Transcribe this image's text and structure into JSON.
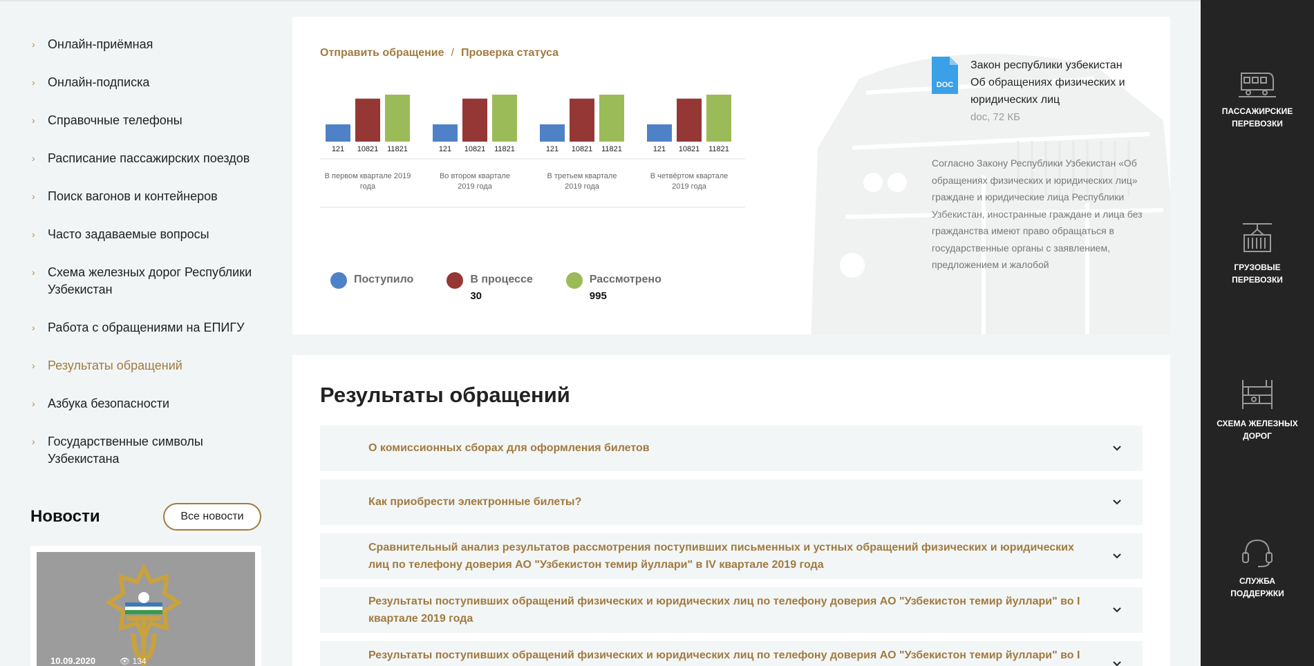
{
  "left_nav": {
    "items": [
      {
        "label": "Онлайн-приёмная"
      },
      {
        "label": "Онлайн-подписка"
      },
      {
        "label": "Справочные телефоны"
      },
      {
        "label": "Расписание пассажирских поездов"
      },
      {
        "label": "Поиск вагонов и контейнеров"
      },
      {
        "label": "Часто задаваемые вопросы"
      },
      {
        "label": "Схема железных дорог Республики Узбекистан"
      },
      {
        "label": "Работа с обращениями на ЕПИГУ"
      },
      {
        "label": "Результаты обращений"
      },
      {
        "label": "Азбука безопасности"
      },
      {
        "label": "Государственные символы Узбекистана"
      }
    ],
    "active_label": "Результаты обращений"
  },
  "news": {
    "title": "Новости",
    "all_button": "Все новости",
    "card": {
      "date": "10.09.2020",
      "views": "134"
    }
  },
  "breadcrumb": {
    "link1": "Отправить обращение",
    "separator": "/",
    "link2": "Проверка статуса"
  },
  "chart_data": {
    "type": "bar",
    "categories": [
      "В первом квартале 2019 года",
      "Во втором квартале 2019 года",
      "В третьем квартале 2019 года",
      "В четвёртом квартале 2019 года"
    ],
    "series": [
      {
        "name": "Поступило",
        "color": "#4f81c7",
        "values": [
          121,
          121,
          121,
          121
        ],
        "value_labels": [
          "121",
          "121",
          "121",
          "121"
        ]
      },
      {
        "name": "В процессе",
        "color": "#953735",
        "values": [
          10821,
          10821,
          10821,
          10821
        ],
        "value_labels": [
          "10821",
          "10821",
          "10821",
          "10821"
        ]
      },
      {
        "name": "Рассмотрено",
        "color": "#9bbb59",
        "values": [
          11821,
          11821,
          11821,
          11821
        ],
        "value_labels": [
          "11821",
          "11821",
          "11821",
          "11821"
        ]
      }
    ],
    "ylim": [
      0,
      11821
    ],
    "legend_position": "bottom-left",
    "grid": false
  },
  "legend": [
    {
      "name": "Поступило",
      "color": "#4f81c7",
      "value": ""
    },
    {
      "name": "В процессе",
      "color": "#953735",
      "value": "30"
    },
    {
      "name": "Рассмотрено",
      "color": "#9bbb59",
      "value": "995"
    }
  ],
  "document": {
    "icon": "doc-file-icon",
    "icon_text": "DOC",
    "title": "Закон республики узбекистан Об обращениях физических и юридических лиц",
    "meta": "doc, 72 КБ",
    "description": "Согласно Закону Республики Узбекистан «Об обращениях физических и юридических лиц» граждане и юридические лица Республики Узбекистан, иностранные граждане и лица без гражданства имеют право обращаться в государственные органы с заявлением, предложением и жалобой"
  },
  "results": {
    "title": "Результаты обращений",
    "items": [
      {
        "text": "О комиссионных сборах для оформления билетов"
      },
      {
        "text": "Как приобрести электронные билеты?"
      },
      {
        "text": "Сравнительный анализ результатов рассмотрения поступивших письменных и устных обращений физических и юридических лиц по телефону доверия АО \"Узбекистон темир йуллари\" в IV квартале 2019 года"
      },
      {
        "text": "Результаты поступивших обращений физических и юридических лиц по телефону доверия АО \"Узбекистон темир йуллари\" во I квартале 2019 года"
      },
      {
        "text": "Результаты поступивших обращений физических и юридических лиц по телефону доверия АО \"Узбекистон темир йуллари\" во I квартале"
      }
    ]
  },
  "right_panel": {
    "items": [
      {
        "label_line1": "ПАССАЖИРСКИЕ",
        "label_line2": "ПЕРЕВОЗКИ",
        "icon": "train-icon"
      },
      {
        "label_line1": "ГРУЗОВЫЕ",
        "label_line2": "ПЕРЕВОЗКИ",
        "icon": "cargo-container-icon"
      },
      {
        "label_line1": "СХЕМА ЖЕЛЕЗНЫХ",
        "label_line2": "ДОРОГ",
        "icon": "rail-map-icon"
      },
      {
        "label_line1": "СЛУЖБА",
        "label_line2": "ПОДДЕРЖКИ",
        "icon": "headset-icon"
      }
    ]
  }
}
